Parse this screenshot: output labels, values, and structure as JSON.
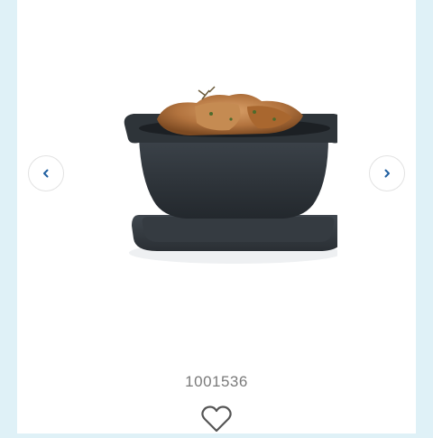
{
  "product": {
    "sku": "1001536",
    "image_description_icon": "product-image"
  },
  "carousel": {
    "prev_icon": "chevron-left-icon",
    "next_icon": "chevron-right-icon",
    "accent_color": "#1f5fa0"
  },
  "wishlist": {
    "icon": "heart-outline-icon"
  },
  "colors": {
    "background": "#dff1f7",
    "page": "#ffffff",
    "sku_text": "#7a7a7a"
  }
}
